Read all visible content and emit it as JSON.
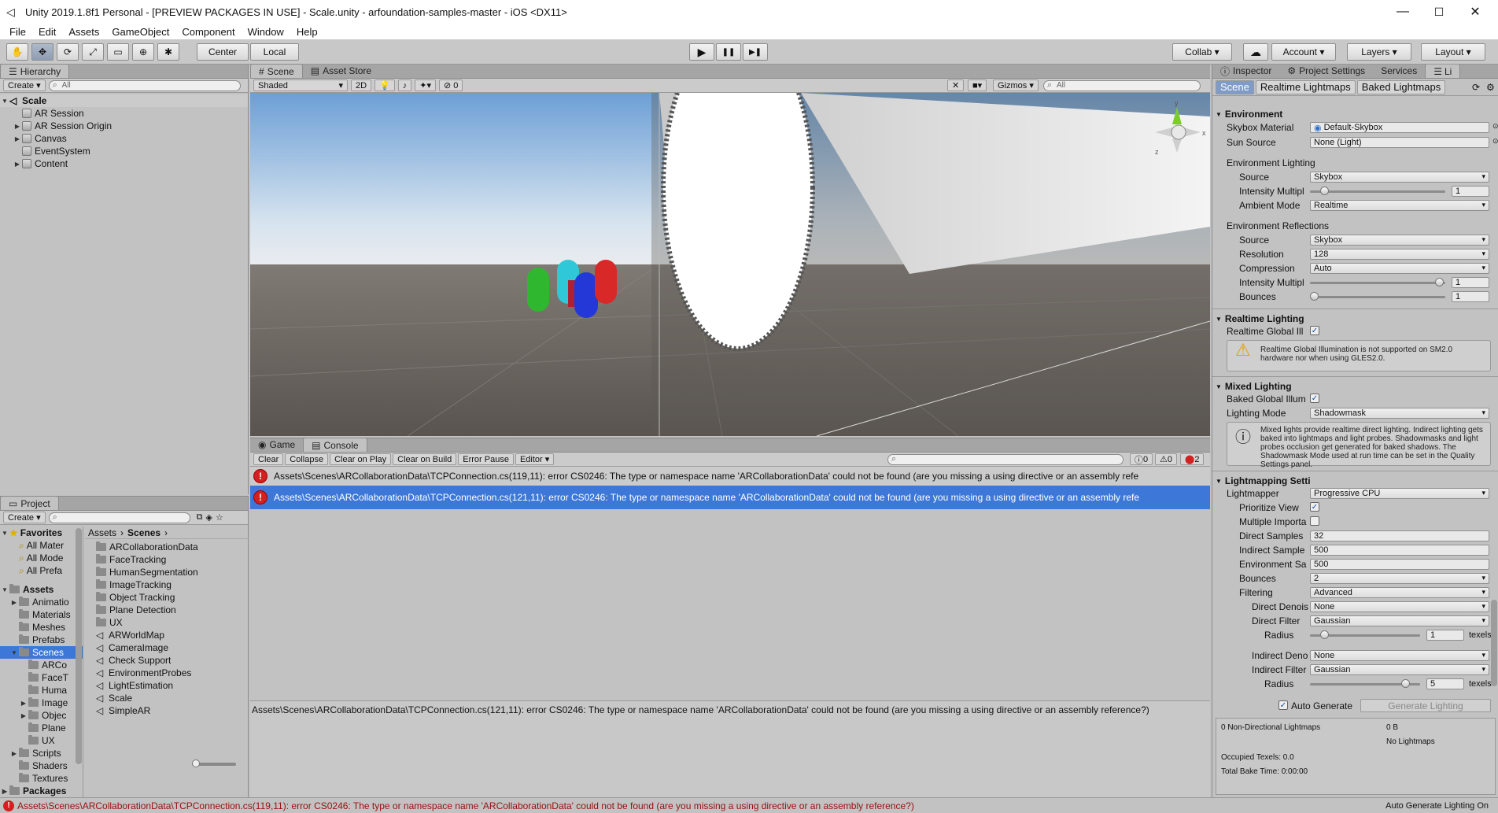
{
  "window": {
    "title": "Unity 2019.1.8f1 Personal - [PREVIEW PACKAGES IN USE] - Scale.unity - arfoundation-samples-master - iOS <DX11>",
    "minimize": "—",
    "maximize": "☐",
    "close": "✕"
  },
  "menu": [
    "File",
    "Edit",
    "Assets",
    "GameObject",
    "Component",
    "Window",
    "Help"
  ],
  "toolbar": {
    "tools": [
      "✋",
      "✥",
      "⟳",
      "⤢",
      "▭",
      "⊕",
      "✱"
    ],
    "center": "Center",
    "local": "Local",
    "play": "▶",
    "pause": "❚❚",
    "step": "▶❚",
    "collab": "Collab ▾",
    "cloud": "☁",
    "account": "Account",
    "layers": "Layers",
    "layout": "Layout"
  },
  "hierarchy": {
    "tab": "Hierarchy",
    "create": "Create",
    "search_placeholder": "All",
    "scene": "Scale",
    "items": [
      {
        "label": "AR Session",
        "expand": ""
      },
      {
        "label": "AR Session Origin",
        "expand": "▶"
      },
      {
        "label": "Canvas",
        "expand": "▶"
      },
      {
        "label": "EventSystem",
        "expand": ""
      },
      {
        "label": "Content",
        "expand": "▶"
      }
    ]
  },
  "scene_view": {
    "tabs": [
      "Scene",
      "Asset Store"
    ],
    "shading": "Shaded",
    "mode2d": "2D",
    "effects_count": "0",
    "gizmos": "Gizmos",
    "search_placeholder": "All",
    "gizmo_labels": {
      "y": "y",
      "x": "x",
      "z": "z"
    }
  },
  "console": {
    "tabs": [
      "Game",
      "Console"
    ],
    "buttons": [
      "Clear",
      "Collapse",
      "Clear on Play",
      "Clear on Build",
      "Error Pause",
      "Editor"
    ],
    "counts": {
      "info": "0",
      "warn": "0",
      "error": "2"
    },
    "rows": [
      "Assets\\Scenes\\ARCollaborationData\\TCPConnection.cs(119,11): error CS0246: The type or namespace name 'ARCollaborationData' could not be found (are you missing a using directive or an assembly refe",
      "Assets\\Scenes\\ARCollaborationData\\TCPConnection.cs(121,11): error CS0246: The type or namespace name 'ARCollaborationData' could not be found (are you missing a using directive or an assembly refe"
    ],
    "detail": "Assets\\Scenes\\ARCollaborationData\\TCPConnection.cs(121,11): error CS0246: The type or namespace name 'ARCollaborationData' could not be found (are you missing a using directive or an assembly reference?)"
  },
  "project": {
    "tab": "Project",
    "create": "Create",
    "favorites_label": "Favorites",
    "favorites": [
      "All Mater",
      "All Mode",
      "All Prefa"
    ],
    "assets_label": "Assets",
    "tree": [
      {
        "label": "Animatio",
        "indent": 1,
        "expand": "▶"
      },
      {
        "label": "Materials",
        "indent": 1,
        "expand": ""
      },
      {
        "label": "Meshes",
        "indent": 1,
        "expand": ""
      },
      {
        "label": "Prefabs",
        "indent": 1,
        "expand": ""
      },
      {
        "label": "Scenes",
        "indent": 1,
        "expand": "▼"
      },
      {
        "label": "ARCo",
        "indent": 2,
        "expand": ""
      },
      {
        "label": "FaceT",
        "indent": 2,
        "expand": ""
      },
      {
        "label": "Huma",
        "indent": 2,
        "expand": ""
      },
      {
        "label": "Image",
        "indent": 2,
        "expand": "▶"
      },
      {
        "label": "Objec",
        "indent": 2,
        "expand": "▶"
      },
      {
        "label": "Plane",
        "indent": 2,
        "expand": ""
      },
      {
        "label": "UX",
        "indent": 2,
        "expand": ""
      },
      {
        "label": "Scripts",
        "indent": 1,
        "expand": "▶"
      },
      {
        "label": "Shaders",
        "indent": 1,
        "expand": ""
      },
      {
        "label": "Textures",
        "indent": 1,
        "expand": ""
      }
    ],
    "packages_label": "Packages",
    "breadcrumb": [
      "Assets",
      "Scenes"
    ],
    "files": [
      {
        "label": "ARCollaborationData",
        "kind": "folder"
      },
      {
        "label": "FaceTracking",
        "kind": "folder"
      },
      {
        "label": "HumanSegmentation",
        "kind": "folder"
      },
      {
        "label": "ImageTracking",
        "kind": "folder"
      },
      {
        "label": "Object Tracking",
        "kind": "folder"
      },
      {
        "label": "Plane Detection",
        "kind": "folder"
      },
      {
        "label": "UX",
        "kind": "folder"
      },
      {
        "label": "ARWorldMap",
        "kind": "scene"
      },
      {
        "label": "CameraImage",
        "kind": "scene"
      },
      {
        "label": "Check Support",
        "kind": "scene"
      },
      {
        "label": "EnvironmentProbes",
        "kind": "scene"
      },
      {
        "label": "LightEstimation",
        "kind": "scene"
      },
      {
        "label": "Scale",
        "kind": "scene"
      },
      {
        "label": "SimpleAR",
        "kind": "scene"
      }
    ]
  },
  "inspector": {
    "tabs": [
      "Inspector",
      "Project Settings",
      "Services",
      "Li"
    ],
    "lighting_tabs": [
      "Scene",
      "Realtime Lightmaps",
      "Baked Lightmaps"
    ],
    "environment": {
      "header": "Environment",
      "skybox_label": "Skybox Material",
      "skybox_value": "Default-Skybox",
      "sun_label": "Sun Source",
      "sun_value": "None (Light)",
      "env_lighting": "Environment Lighting",
      "source_label": "Source",
      "source_value": "Skybox",
      "intensity_label": "Intensity Multipl",
      "intensity_value": "1",
      "intensity_level": 0.08,
      "ambient_label": "Ambient Mode",
      "ambient_value": "Realtime",
      "env_reflections": "Environment Reflections",
      "refl_source_label": "Source",
      "refl_source_value": "Skybox",
      "resolution_label": "Resolution",
      "resolution_value": "128",
      "compression_label": "Compression",
      "compression_value": "Auto",
      "refl_intensity_label": "Intensity Multipl",
      "refl_intensity_value": "1",
      "refl_intensity_level": 0.99,
      "bounces_label": "Bounces",
      "bounces_value": "1",
      "bounces_level": 0.0
    },
    "realtime": {
      "header": "Realtime Lighting",
      "gi_label": "Realtime Global Ill",
      "gi_checked": "✓",
      "warning": "Realtime Global Illumination is not supported on SM2.0 hardware nor when using GLES2.0."
    },
    "mixed": {
      "header": "Mixed Lighting",
      "baked_label": "Baked Global Illum",
      "baked_checked": "✓",
      "mode_label": "Lighting Mode",
      "mode_value": "Shadowmask",
      "info": "Mixed lights provide realtime direct lighting. Indirect lighting gets baked into lightmaps and light probes. Shadowmasks and light probes occlusion get generated for baked shadows. The Shadowmask Mode used at run time can be set in the Quality Settings panel."
    },
    "lightmapping": {
      "header": "Lightmapping Setti",
      "lightmapper_label": "Lightmapper",
      "lightmapper_value": "Progressive CPU",
      "prioritize_label": "Prioritize View",
      "prioritize_checked": "✓",
      "multiple_label": "Multiple Importa",
      "direct_samples_label": "Direct Samples",
      "direct_samples_value": "32",
      "indirect_samples_label": "Indirect Sample",
      "indirect_samples_value": "500",
      "env_samples_label": "Environment Sa",
      "env_samples_value": "500",
      "bounces_label": "Bounces",
      "bounces_value": "2",
      "filtering_label": "Filtering",
      "filtering_value": "Advanced",
      "direct_denoiser_label": "Direct Denois",
      "direct_denoiser_value": "None",
      "direct_filter_label": "Direct Filter",
      "direct_filter_value": "Gaussian",
      "radius1_label": "Radius",
      "radius1_value": "1",
      "radius1_level": 0.1,
      "texels": "texels",
      "indirect_denoiser_label": "Indirect Deno",
      "indirect_denoiser_value": "None",
      "indirect_filter_label": "Indirect Filter",
      "indirect_filter_value": "Gaussian",
      "radius2_label": "Radius",
      "radius2_value": "5",
      "radius2_level": 0.9
    },
    "auto_generate": "Auto Generate",
    "auto_checked": "✓",
    "generate_button": "Generate Lighting",
    "stats": {
      "lightmaps": "0 Non-Directional Lightmaps",
      "size": "0 B",
      "none": "No Lightmaps",
      "texels": "Occupied Texels: 0.0",
      "bake_time": "Total Bake Time: 0:00:00"
    }
  },
  "status": {
    "message": "Assets\\Scenes\\ARCollaborationData\\TCPConnection.cs(119,11): error CS0246: The type or namespace name 'ARCollaborationData' could not be found (are you missing a using directive or an assembly reference?)",
    "right": "Auto Generate Lighting On"
  },
  "colors": {
    "selection": "#3d78d8",
    "error": "#d32020"
  }
}
